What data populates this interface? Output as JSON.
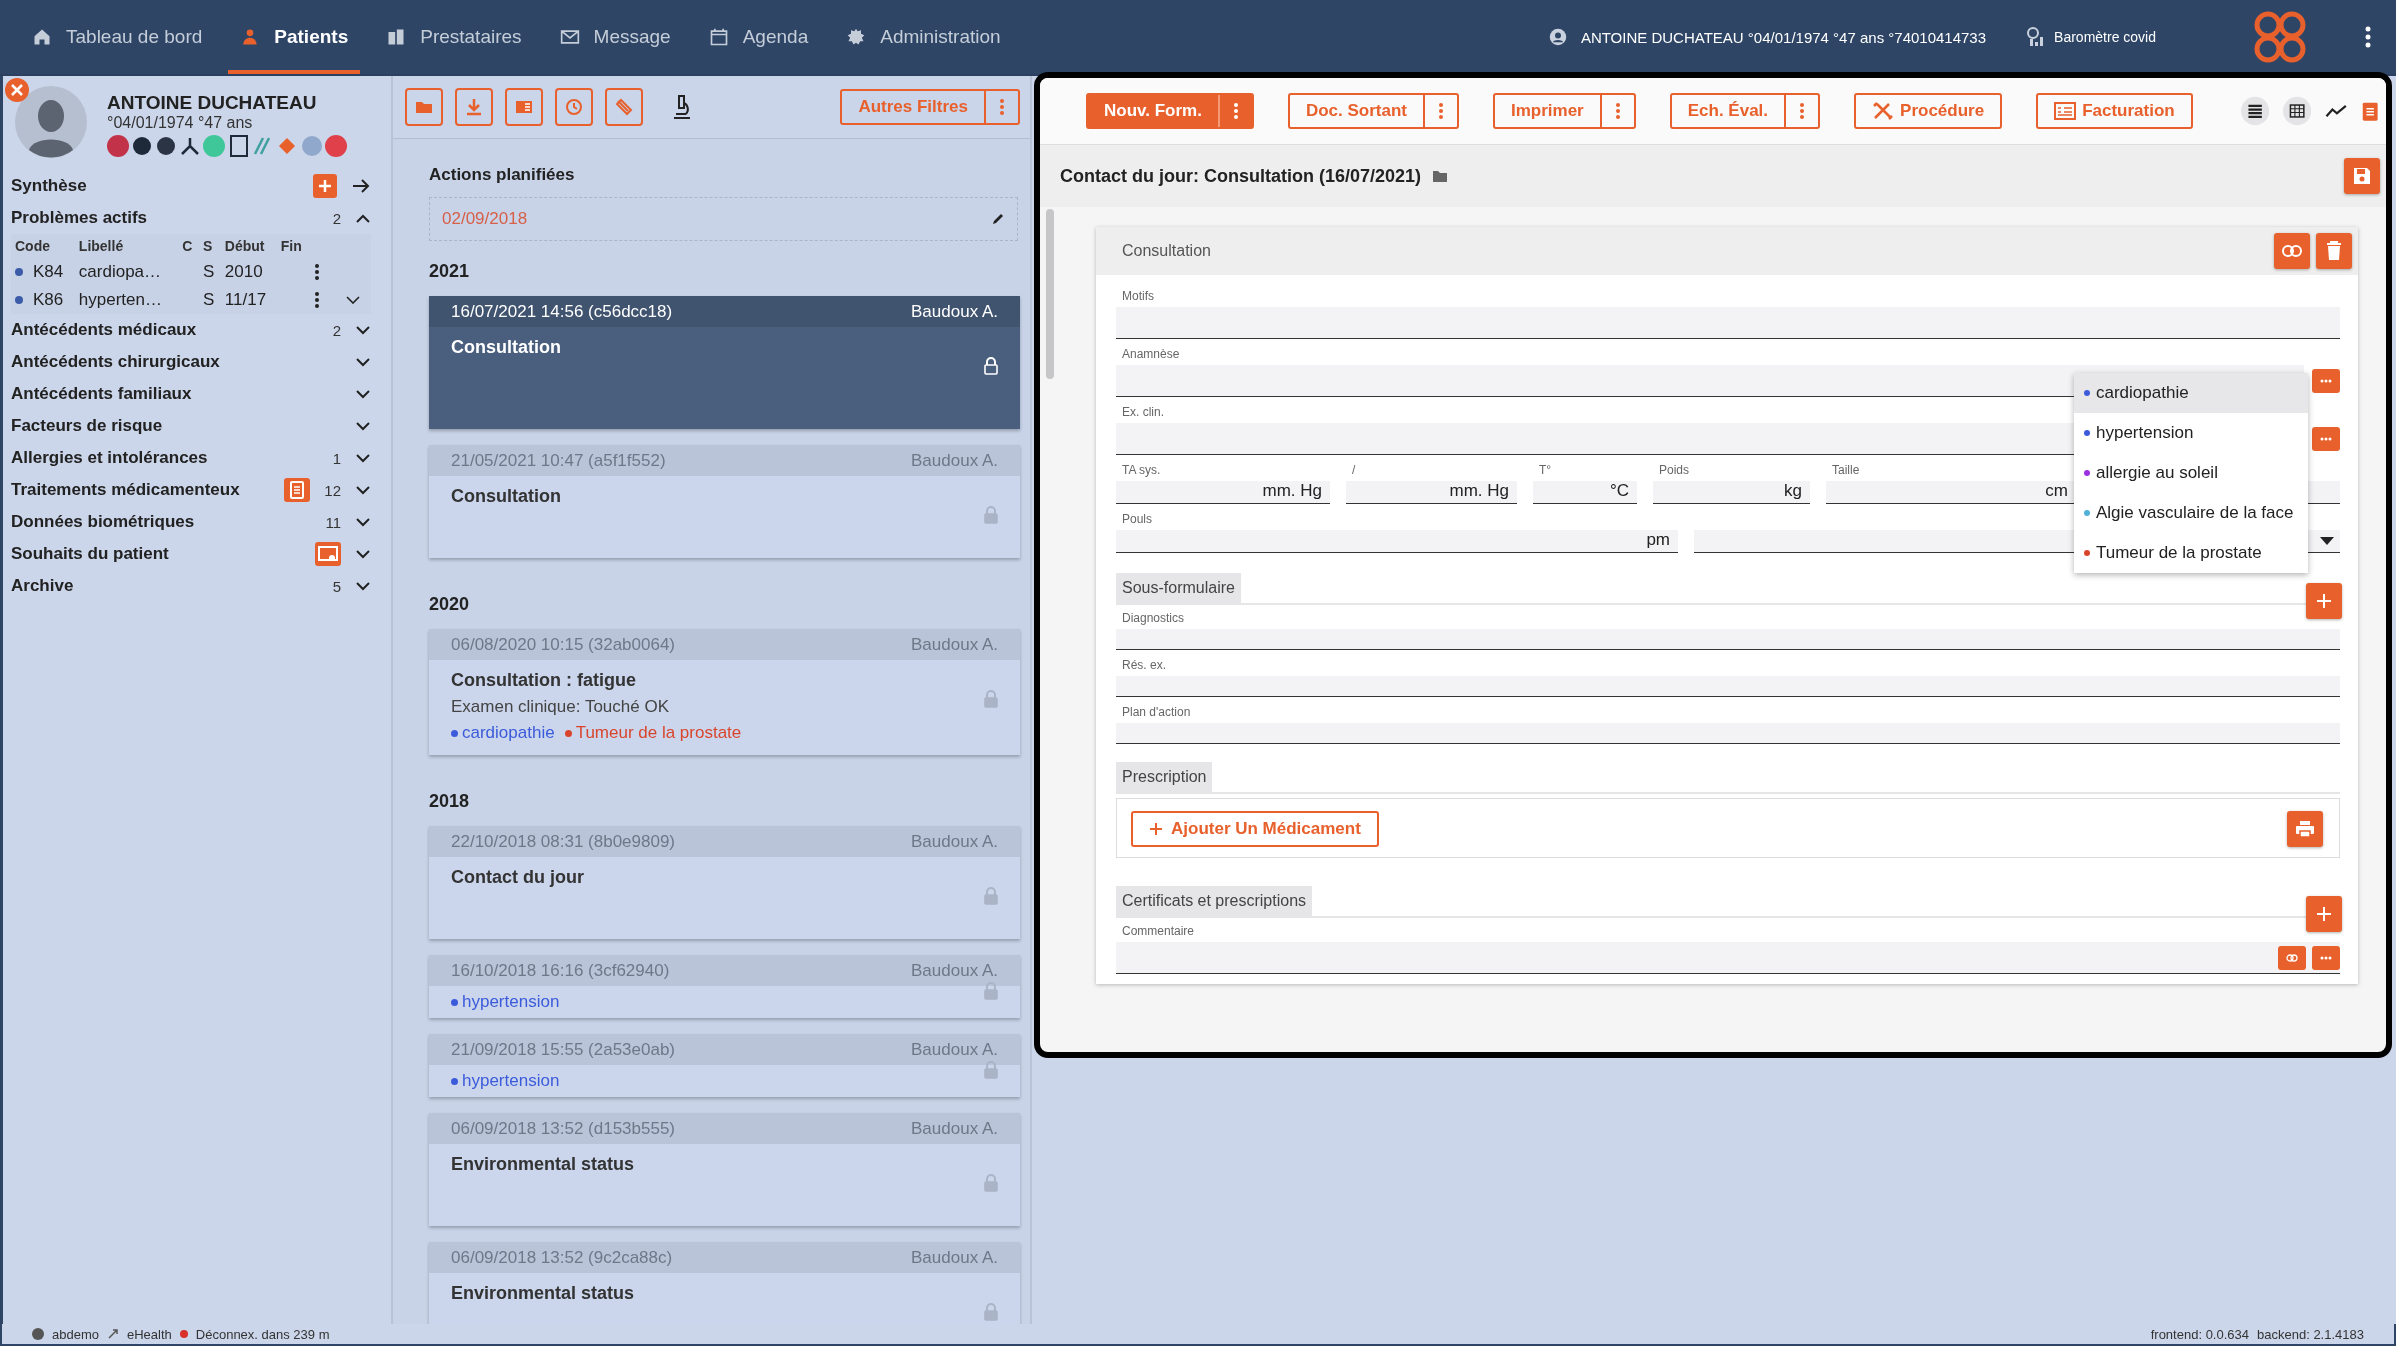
{
  "nav": {
    "items": [
      {
        "label": "Tableau de bord",
        "selected": false
      },
      {
        "label": "Patients",
        "selected": true
      },
      {
        "label": "Prestataires",
        "selected": false
      },
      {
        "label": "Message",
        "selected": false
      },
      {
        "label": "Agenda",
        "selected": false
      },
      {
        "label": "Administration",
        "selected": false
      }
    ],
    "user": "ANTOINE DUCHATEAU °04/01/1974 °47 ans °74010414733",
    "barometer": "Baromètre covid"
  },
  "patient": {
    "name": "ANTOINE DUCHATEAU",
    "birth": "°04/01/1974 °47 ans"
  },
  "sidebar": {
    "synthese": "Synthèse",
    "sections": [
      {
        "label": "Problèmes actifs",
        "count": "2",
        "expanded": true
      },
      {
        "label": "Antécédents médicaux",
        "count": "2",
        "expanded": false
      },
      {
        "label": "Antécédents chirurgicaux",
        "expanded": false
      },
      {
        "label": "Antécédents familiaux",
        "expanded": false
      },
      {
        "label": "Facteurs de risque",
        "expanded": false
      },
      {
        "label": "Allergies et intolérances",
        "count": "1",
        "expanded": false
      },
      {
        "label": "Traitements médicamenteux",
        "count": "12",
        "expanded": false
      },
      {
        "label": "Données biométriques",
        "count": "11",
        "expanded": false
      },
      {
        "label": "Souhaits du patient",
        "expanded": false
      },
      {
        "label": "Archive",
        "count": "5",
        "expanded": false
      }
    ],
    "problems": {
      "columns": [
        "Code",
        "Libellé",
        "C",
        "S",
        "Début",
        "Fin"
      ],
      "rows": [
        {
          "code": "K84",
          "label": "cardiopa…",
          "s": "S",
          "start": "2010"
        },
        {
          "code": "K86",
          "label": "hyperten…",
          "s": "S",
          "start": "11/17"
        }
      ]
    }
  },
  "journal": {
    "filter": "Autres Filtres",
    "planned_title": "Actions planifiées",
    "planned_date": "02/09/2018",
    "groups": [
      {
        "year": "2021",
        "entries": [
          {
            "header": "16/07/2021 14:56 (c56dcc18)",
            "author": "Baudoux A.",
            "title": "Consultation",
            "selected": true
          },
          {
            "header": "21/05/2021 10:47 (a5f1f552)",
            "author": "Baudoux A.",
            "title": "Consultation",
            "selected": false
          }
        ]
      },
      {
        "year": "2020",
        "entries": [
          {
            "header": "06/08/2020 10:15 (32ab0064)",
            "author": "Baudoux A.",
            "title": "Consultation : fatigue",
            "lines": [
              "Examen clinique: Touché OK"
            ],
            "tags": [
              {
                "label": "cardiopathie",
                "color": "#3b5bdb"
              },
              {
                "label": "Tumeur de la prostate",
                "color": "#d9452c"
              }
            ],
            "selected": false
          }
        ]
      },
      {
        "year": "2018",
        "entries": [
          {
            "header": "22/10/2018 08:31 (8b0e9809)",
            "author": "Baudoux A.",
            "title": "Contact du jour",
            "selected": false
          },
          {
            "header": "16/10/2018 16:16 (3cf62940)",
            "author": "Baudoux A.",
            "tags": [
              {
                "label": "hypertension",
                "color": "#3b5bdb"
              }
            ],
            "selected": false
          },
          {
            "header": "21/09/2018 15:55 (2a53e0ab)",
            "author": "Baudoux A.",
            "tags": [
              {
                "label": "hypertension",
                "color": "#3b5bdb"
              }
            ],
            "selected": false
          },
          {
            "header": "06/09/2018 13:52 (d153b555)",
            "author": "Baudoux A.",
            "title": "Environmental status",
            "selected": false
          },
          {
            "header": "06/09/2018 13:52 (9c2ca88c)",
            "author": "Baudoux A.",
            "title": "Environmental status",
            "selected": false
          }
        ]
      }
    ]
  },
  "toolbar": [
    {
      "label": "Nouv. Form.",
      "menu": true
    },
    {
      "label": "Doc. Sortant",
      "menu": true
    },
    {
      "label": "Imprimer",
      "menu": true
    },
    {
      "label": "Ech. Éval.",
      "menu": true
    },
    {
      "label": "Procédure",
      "menu": false
    },
    {
      "label": "Facturation",
      "menu": false
    }
  ],
  "form": {
    "title": "Contact du jour: Consultation (16/07/2021)",
    "card_title": "Consultation",
    "fields": [
      {
        "label": "Motifs",
        "more": false
      },
      {
        "label": "Anamnèse",
        "more": true
      },
      {
        "label": "Ex. clin.",
        "more": true
      }
    ],
    "vitals": [
      {
        "label": "TA sys.",
        "unit": "mm. Hg"
      },
      {
        "label": "/",
        "unit": "mm. Hg"
      },
      {
        "label": "T°",
        "unit": "°C"
      },
      {
        "label": "Poids",
        "unit": "kg"
      },
      {
        "label": "Taille",
        "unit": "cm"
      }
    ],
    "pulse": {
      "label": "Pouls",
      "unit": "pm"
    },
    "subform": {
      "title": "Sous-formulaire",
      "fields": [
        {
          "label": "Diagnostics"
        },
        {
          "label": "Rés. ex."
        },
        {
          "label": "Plan d'action"
        }
      ]
    },
    "prescription": {
      "title": "Prescription",
      "add": "Ajouter Un Médicament"
    },
    "certificates": {
      "title": "Certificats et prescriptions",
      "fields": [
        {
          "label": "Commentaire"
        }
      ]
    },
    "dropdown": [
      {
        "label": "cardiopathie",
        "color": "#3b5bdb",
        "selected": true
      },
      {
        "label": "hypertension",
        "color": "#3b5bdb",
        "selected": false
      },
      {
        "label": "allergie au soleil",
        "color": "#9b30e0",
        "selected": false
      },
      {
        "label": "Algie vasculaire de la face",
        "color": "#4fb0d8",
        "selected": false
      },
      {
        "label": "Tumeur de la prostate",
        "color": "#d9452c",
        "selected": false
      }
    ]
  },
  "status_bar": {
    "user": "abdemo",
    "ehealth": "eHealth",
    "logout": "Déconnex. dans 239 m",
    "frontend": "frontend: 0.0.634",
    "backend": "backend: 2.1.4183"
  }
}
